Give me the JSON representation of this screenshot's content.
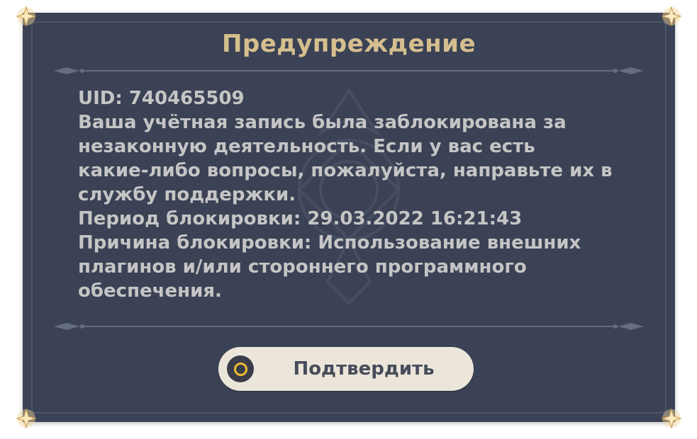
{
  "dialog": {
    "title": "Предупреждение",
    "message_lines": [
      "UID: 740465509",
      "Ваша учётная запись была заблокирована за",
      "незаконную деятельность. Если у вас есть",
      "какие-либо вопросы, пожалуйста, направьте их в",
      "службу поддержки.",
      "Период блокировки: 29.03.2022 16:21:43",
      "Причина блокировки: Использование внешних",
      "плагинов и/или стороннего программного",
      "обеспечения."
    ],
    "confirm_label": "Подтвердить"
  },
  "icons": {
    "corner": "corner-star-ornament-icon",
    "divider": "ornamental-divider",
    "watermark": "emblem-watermark-icon",
    "confirm": "confirm-circle-icon"
  },
  "colors": {
    "panel_background": "#3b4255",
    "title": "#d6bf8e",
    "text": "#c5c5c5",
    "button_background": "#ece6da",
    "button_text": "#474c5b",
    "button_icon_ring": "#f0bb33"
  }
}
